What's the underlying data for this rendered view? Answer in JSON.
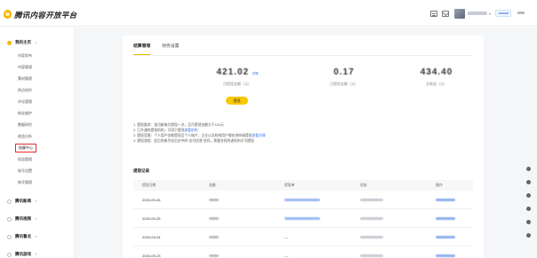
{
  "app": {
    "title": "腾讯内容开放平台"
  },
  "sidebar": {
    "sections": [
      {
        "label": "我的主页",
        "icon": "home-icon",
        "color": "#f7b500"
      },
      {
        "label": "腾讯新闻",
        "icon": "news-icon",
        "color": "#bdbdbd"
      },
      {
        "label": "腾讯视频",
        "icon": "video-icon",
        "color": "#bdbdbd"
      },
      {
        "label": "腾讯看点",
        "icon": "kandian-icon",
        "color": "#bdbdbd"
      },
      {
        "label": "腾讯游戏",
        "icon": "game-icon",
        "color": "#bdbdbd"
      }
    ],
    "items": [
      "内容发布",
      "内容管理",
      "素材管理",
      "热点创作",
      "评论管理",
      "粉丝维护",
      "数据研究",
      "收益分析",
      "结算中心",
      "权益管理",
      "账号设置",
      "账号管理"
    ],
    "active_item": "结算中心"
  },
  "tabs": [
    "结算管理",
    "财务设置"
  ],
  "stats": [
    {
      "value": "421.02",
      "label": "可提现金额（元）",
      "tag": "详情"
    },
    {
      "value": "0.17",
      "label": "已提现金额（元）"
    },
    {
      "value": "434.40",
      "label": "总收益（元）"
    }
  ],
  "withdraw_button": "提现",
  "notes": [
    {
      "text": "1. 提现要求：准功能每月提现一次，且可提现金额大于100元"
    },
    {
      "text": "2. 已开通的提现机构，可用于提现",
      "link": "查看机构"
    },
    {
      "text": "3. 提现范围：个人用户仅能提现至个人账户，企业以及机构用户需在线申请提现",
      "link": "查看详情"
    },
    {
      "text": "4. 提现流程：此后的账号在后台中的“支付信息”合同，需要合同所述机构才可提现"
    }
  ],
  "records": {
    "title": "提现记录",
    "columns": [
      "提现日期",
      "金额",
      "提现单",
      "状态",
      "操作"
    ],
    "rows": [
      {
        "date": "2020-09-26",
        "order": true
      },
      {
        "date": "2020-09-25",
        "order": true
      },
      {
        "date": "2020-09-24",
        "order": false,
        "dash": "—"
      },
      {
        "date": "2020-09-23",
        "order": false,
        "dash": "—"
      }
    ]
  },
  "accent_color": "#f7b500"
}
